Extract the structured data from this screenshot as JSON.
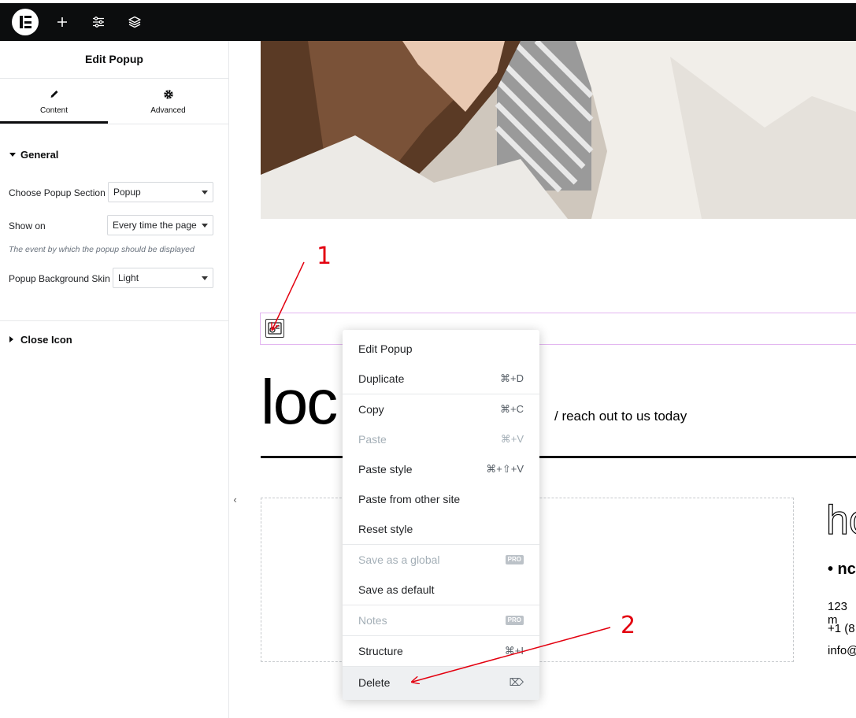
{
  "topbar": {
    "logo_icon": "elementor-logo-icon",
    "add_icon": "plus-icon",
    "settings_icon": "sliders-icon",
    "structure_icon": "layers-icon"
  },
  "panel": {
    "title": "Edit Popup",
    "tabs": [
      {
        "label": "Content",
        "icon": "pencil-icon",
        "active": true
      },
      {
        "label": "Advanced",
        "icon": "gear-icon",
        "active": false
      }
    ],
    "general_section": {
      "title": "General",
      "fields": [
        {
          "label": "Choose Popup Section",
          "value": "Popup"
        },
        {
          "label": "Show on",
          "value": "Every time the page"
        },
        {
          "label": "Popup Background Skin",
          "value": "Light"
        }
      ],
      "show_on_description": "The event by which the popup should be displayed"
    },
    "close_icon_section": {
      "title": "Close Icon"
    },
    "collapse_glyph": "‹"
  },
  "canvas": {
    "heading": "loc",
    "subheading": "/ reach out to us today",
    "outline_text": "ho",
    "bullet_text": "• nc",
    "info_lines": [
      "123 m",
      "+1 (8",
      "info@"
    ]
  },
  "context_menu": {
    "items": [
      {
        "label": "Edit Popup",
        "shortcut": ""
      },
      {
        "label": "Duplicate",
        "shortcut": "⌘+D"
      },
      {
        "label": "Copy",
        "shortcut": "⌘+C"
      },
      {
        "label": "Paste",
        "shortcut": "⌘+V",
        "disabled": true
      },
      {
        "label": "Paste style",
        "shortcut": "⌘+⇧+V"
      },
      {
        "label": "Paste from other site",
        "shortcut": ""
      },
      {
        "label": "Reset style",
        "shortcut": ""
      },
      {
        "label": "Save as a global",
        "badge": "PRO",
        "disabled": true
      },
      {
        "label": "Save as default",
        "shortcut": ""
      },
      {
        "label": "Notes",
        "badge": "PRO",
        "disabled": true
      },
      {
        "label": "Structure",
        "shortcut": "⌘+I"
      },
      {
        "label": "Delete",
        "shortcut": "⌦",
        "hovered": true
      }
    ]
  },
  "annotations": {
    "step1": "1",
    "step2": "2",
    "color": "#e3000f"
  },
  "colors": {
    "topbar_bg": "#0c0d0e",
    "selection_outline": "#e3b6f0",
    "annotation": "#e3000f"
  }
}
